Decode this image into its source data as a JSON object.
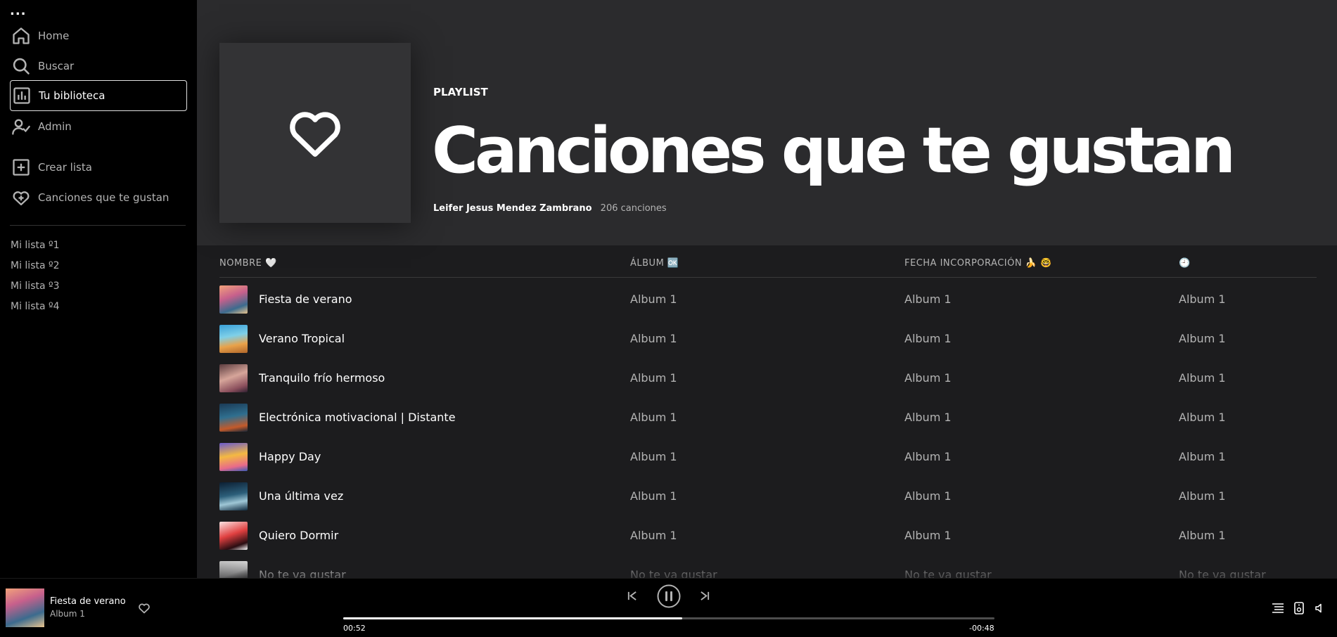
{
  "sidebar": {
    "menu_label": "...",
    "nav": [
      {
        "label": "Home"
      },
      {
        "label": "Buscar"
      },
      {
        "label": "Tu biblioteca"
      },
      {
        "label": "Admin"
      }
    ],
    "actions": [
      {
        "label": "Crear lista"
      },
      {
        "label": "Canciones que te gustan"
      }
    ],
    "playlists": [
      "Mi lista º1",
      "Mi lista º2",
      "Mi lista º3",
      "Mi lista º4"
    ]
  },
  "header": {
    "type": "PLAYLIST",
    "title": "Canciones que te gustan",
    "owner": "Leifer Jesus Mendez Zambrano",
    "count": "206 canciones"
  },
  "table": {
    "columns": [
      "NOMBRE 🤍",
      "ÁLBUM 🆗",
      "FECHA INCORPORACIÓN 🍌 🤓",
      "🕘"
    ],
    "rows": [
      {
        "title": "Fiesta de verano",
        "album": "Album 1",
        "date": "Album 1",
        "duration": "Album 1"
      },
      {
        "title": "Verano Tropical",
        "album": "Album 1",
        "date": "Album 1",
        "duration": "Album 1"
      },
      {
        "title": "Tranquilo frío hermoso",
        "album": "Album 1",
        "date": "Album 1",
        "duration": "Album 1"
      },
      {
        "title": "Electrónica motivacional | Distante",
        "album": "Album 1",
        "date": "Album 1",
        "duration": "Album 1"
      },
      {
        "title": "Happy Day",
        "album": "Album 1",
        "date": "Album 1",
        "duration": "Album 1"
      },
      {
        "title": "Una última vez",
        "album": "Album 1",
        "date": "Album 1",
        "duration": "Album 1"
      },
      {
        "title": "Quiero Dormir",
        "album": "Album 1",
        "date": "Album 1",
        "duration": "Album 1"
      },
      {
        "title": "No te va gustar",
        "album": "No te va gustar",
        "date": "No te va gustar",
        "duration": "No te va gustar"
      }
    ]
  },
  "player": {
    "title": "Fiesta de verano",
    "album": "Album 1",
    "elapsed": "00:52",
    "remaining": "-00:48",
    "progress_fraction": 0.52
  },
  "colors": {
    "sidebar_bg": "#000000",
    "header_bg": "#2b2b2d",
    "main_bg": "#1c1c1e",
    "text_secondary": "#b3b3b3"
  }
}
